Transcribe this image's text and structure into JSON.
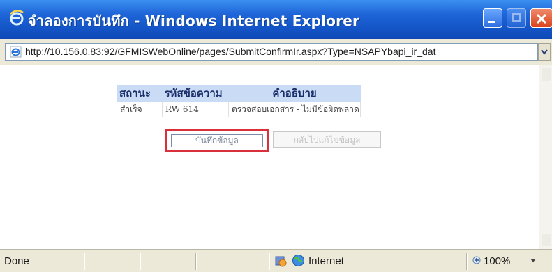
{
  "window": {
    "title": "จำลองการบันทึก - Windows Internet Explorer",
    "address": "http://10.156.0.83:92/GFMISWebOnline/pages/SubmitConfirmIr.aspx?Type=NSAPYbapi_ir_dat"
  },
  "table": {
    "headers": [
      "สถานะ",
      "รหัสข้อความ",
      "คำอธิบาย"
    ],
    "rows": [
      [
        "สำเร็จ",
        "RW 614",
        "ตรวจสอบเอกสาร - ไม่มีข้อผิดพลาด :"
      ]
    ]
  },
  "buttons": {
    "save": "บันทึกข้อมูล",
    "back": "กลับไปแก้ไขข้อมูล"
  },
  "statusbar": {
    "status": "Done",
    "zone": "Internet",
    "zoom": "100%"
  },
  "colors": {
    "titlebar": "#1f66d9",
    "highlight_border": "#d9303b",
    "table_header_bg": "#c9dbf5"
  },
  "icons": [
    "ie-logo-icon",
    "minimize-icon",
    "maximize-icon",
    "close-icon",
    "page-icon",
    "dropdown-icon",
    "protected-mode-icon",
    "globe-icon",
    "zoom-icon"
  ]
}
